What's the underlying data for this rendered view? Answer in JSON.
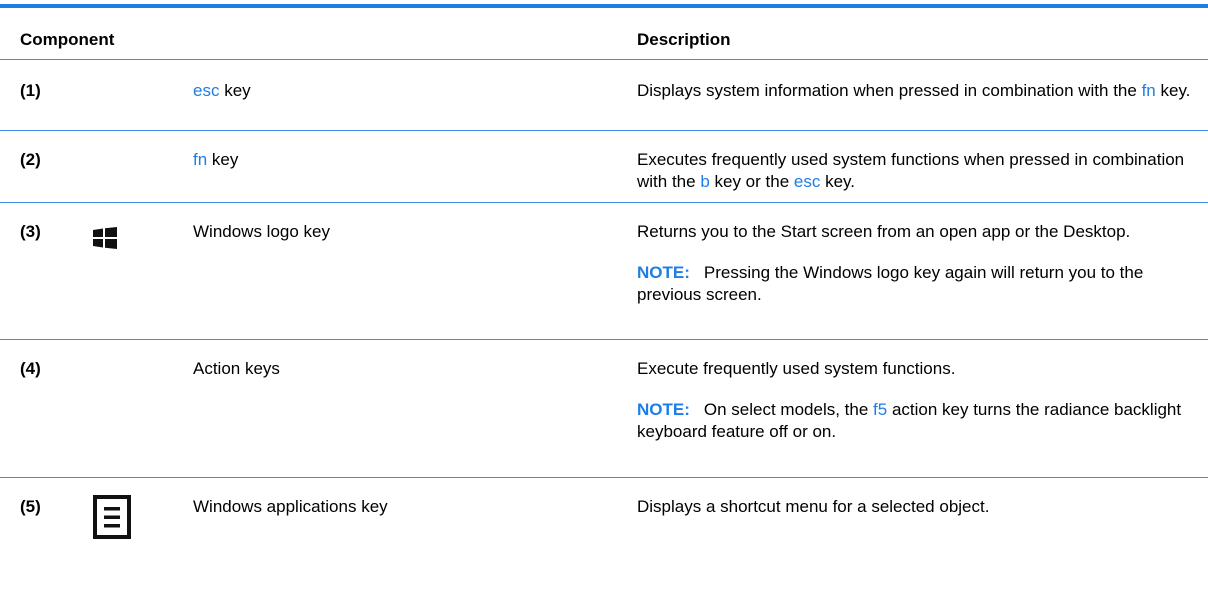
{
  "header": {
    "component": "Component",
    "description": "Description"
  },
  "rows": [
    {
      "num": "(1)",
      "comp_key": "esc",
      "comp_suffix": " key",
      "desc": {
        "t1": "Displays system information when pressed in combination with the ",
        "k1": "fn",
        "t2": " key."
      }
    },
    {
      "num": "(2)",
      "comp_key": "fn",
      "comp_suffix": " key",
      "desc": {
        "t1": "Executes frequently used system functions when pressed in combination with the ",
        "k1": "b",
        "t2": " key or the ",
        "k2": "esc",
        "t3": " key."
      }
    },
    {
      "num": "(3)",
      "icon": "windows-logo-icon",
      "comp": "Windows logo key",
      "desc": "Returns you to the Start screen from an open app or the Desktop.",
      "note": {
        "label": "NOTE:",
        "text": "Pressing the Windows logo key again will return you to the previous screen."
      }
    },
    {
      "num": "(4)",
      "comp": "Action keys",
      "desc": "Execute frequently used system functions.",
      "note": {
        "label": "NOTE:",
        "t1": "On select models, the ",
        "k1": "f5",
        "t2": " action key turns the radiance backlight keyboard feature off or on."
      }
    },
    {
      "num": "(5)",
      "icon": "applications-key-icon",
      "comp": "Windows applications key",
      "desc": "Displays a shortcut menu for a selected object."
    }
  ],
  "colors": {
    "accent": "#1e7ee6",
    "text": "#000000",
    "background": "#ffffff"
  }
}
